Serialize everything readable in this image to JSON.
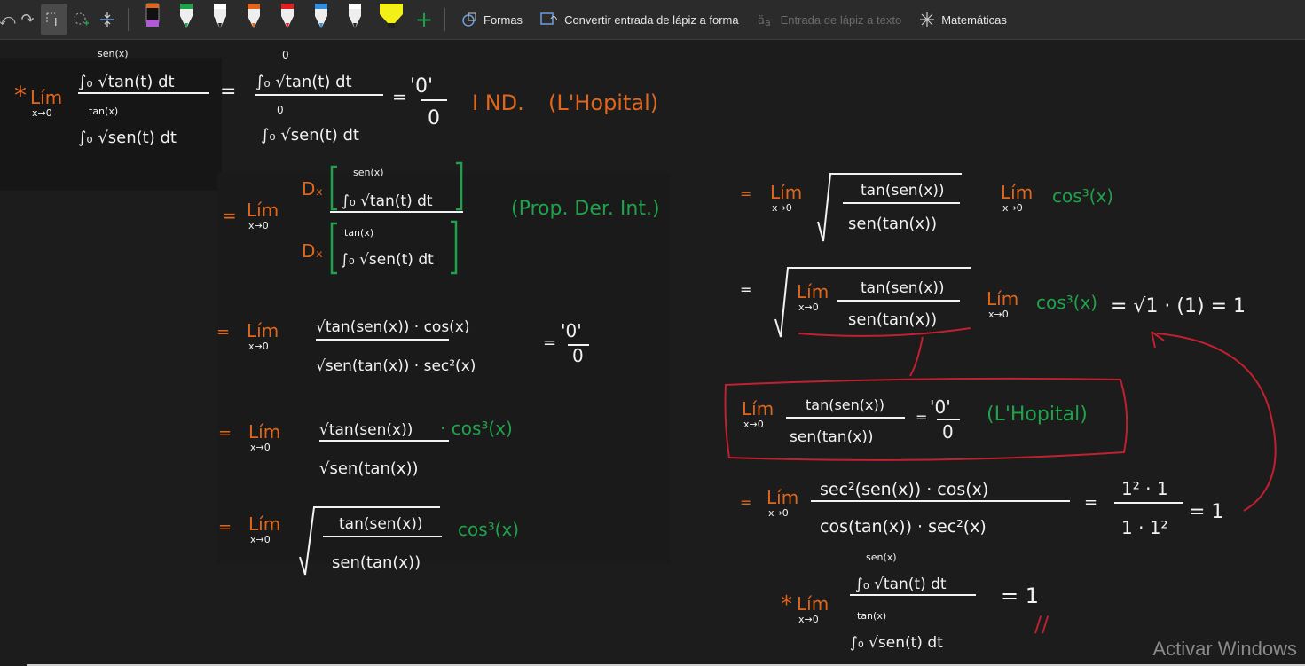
{
  "toolbar": {
    "shapes_label": "Formas",
    "ink_to_shape_label": "Convertir entrada de lápiz a forma",
    "ink_to_text_label": "Entrada de lápiz a texto",
    "math_label": "Matemáticas",
    "pens": [
      {
        "name": "black-purple-pen",
        "color": "#111111",
        "tip": "#b05bd6"
      },
      {
        "name": "green-pen",
        "color": "#1fa34a"
      },
      {
        "name": "white-pen",
        "color": "#f2f2f2"
      },
      {
        "name": "orange-pen",
        "color": "#e0661c"
      },
      {
        "name": "red-pen",
        "color": "#e02020"
      },
      {
        "name": "blue-pen",
        "color": "#2f8fe0"
      },
      {
        "name": "white-pen-2",
        "color": "#ffffff"
      },
      {
        "name": "yellow-highlighter",
        "color": "#f3f018"
      }
    ]
  },
  "ink": {
    "lim": "Lím",
    "lim_sub": "x→0",
    "star": "*",
    "eq": "=",
    "step1_num_upper": "sen(x)",
    "step1_num_body": "∫₀ √tan(t) dt",
    "step1_den_upper": "tan(x)",
    "step1_den_body": "∫₀ √sen(t) dt",
    "zero_upper": "0",
    "zero_frac_num": "'0'",
    "zero_frac_den": "0",
    "ind": "I ND.",
    "lhopital": "(L'Hopital)",
    "dx": "Dₓ",
    "prop": "(Prop. Der. Int.)",
    "s3_num": "√tan(sen(x)) · cos(x)",
    "s3_den": "√sen(tan(x)) · sec²(x)",
    "s4_num": "√tan(sen(x))",
    "s4_cos": "· cos³(x)",
    "s4_den": "√sen(tan(x))",
    "frac_num": "tan(sen(x))",
    "frac_den": "sen(tan(x))",
    "cos3": "cos³(x)",
    "r_result": "= √1 · (1) = 1",
    "box_eq_frac_num": "'0'",
    "box_eq_frac_den": "0",
    "box_lhopital": "(L'Hopital)",
    "r_num": "sec²(sen(x)) · cos(x)",
    "r_den": "cos(tan(x)) · sec²(x)",
    "r_ones_num": "1² · 1",
    "r_ones_den": "1 · 1²",
    "r_one": "= 1",
    "final_eq": "= 1",
    "final_mark": "//"
  },
  "watermark": "Activar Windows",
  "colors": {
    "orange": "#e0661c",
    "green": "#1fa34a",
    "white": "#f2f2f2",
    "red": "#c0202f",
    "toolbar": "#2b2b2b",
    "canvas": "#1c1c1c"
  }
}
